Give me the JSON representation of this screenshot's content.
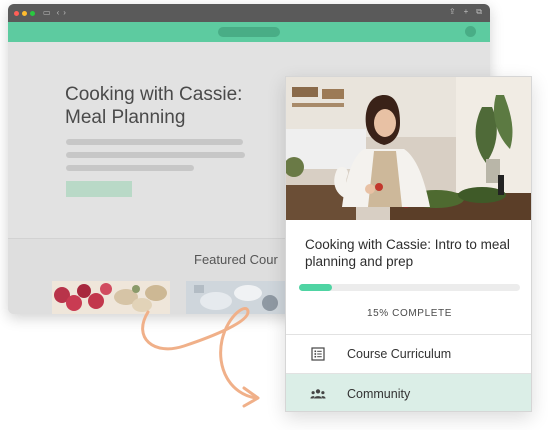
{
  "background_page": {
    "course_title_line1": "Cooking with Cassie:",
    "course_title_line2": "Meal Planning",
    "featured_heading": "Featured Cour"
  },
  "card": {
    "title": "Cooking with Cassie: Intro to meal planning and prep",
    "progress": {
      "percent": 15,
      "label": "15% COMPLETE"
    },
    "menu": [
      {
        "label": "Course Curriculum",
        "icon": "list-icon"
      },
      {
        "label": "Community",
        "icon": "people-icon",
        "selected": true
      }
    ]
  },
  "colors": {
    "accent_green": "#5dcba0",
    "progress_fill": "#4fd4a3",
    "selected_row": "#dbeee7",
    "arrow": "#f0b089"
  }
}
